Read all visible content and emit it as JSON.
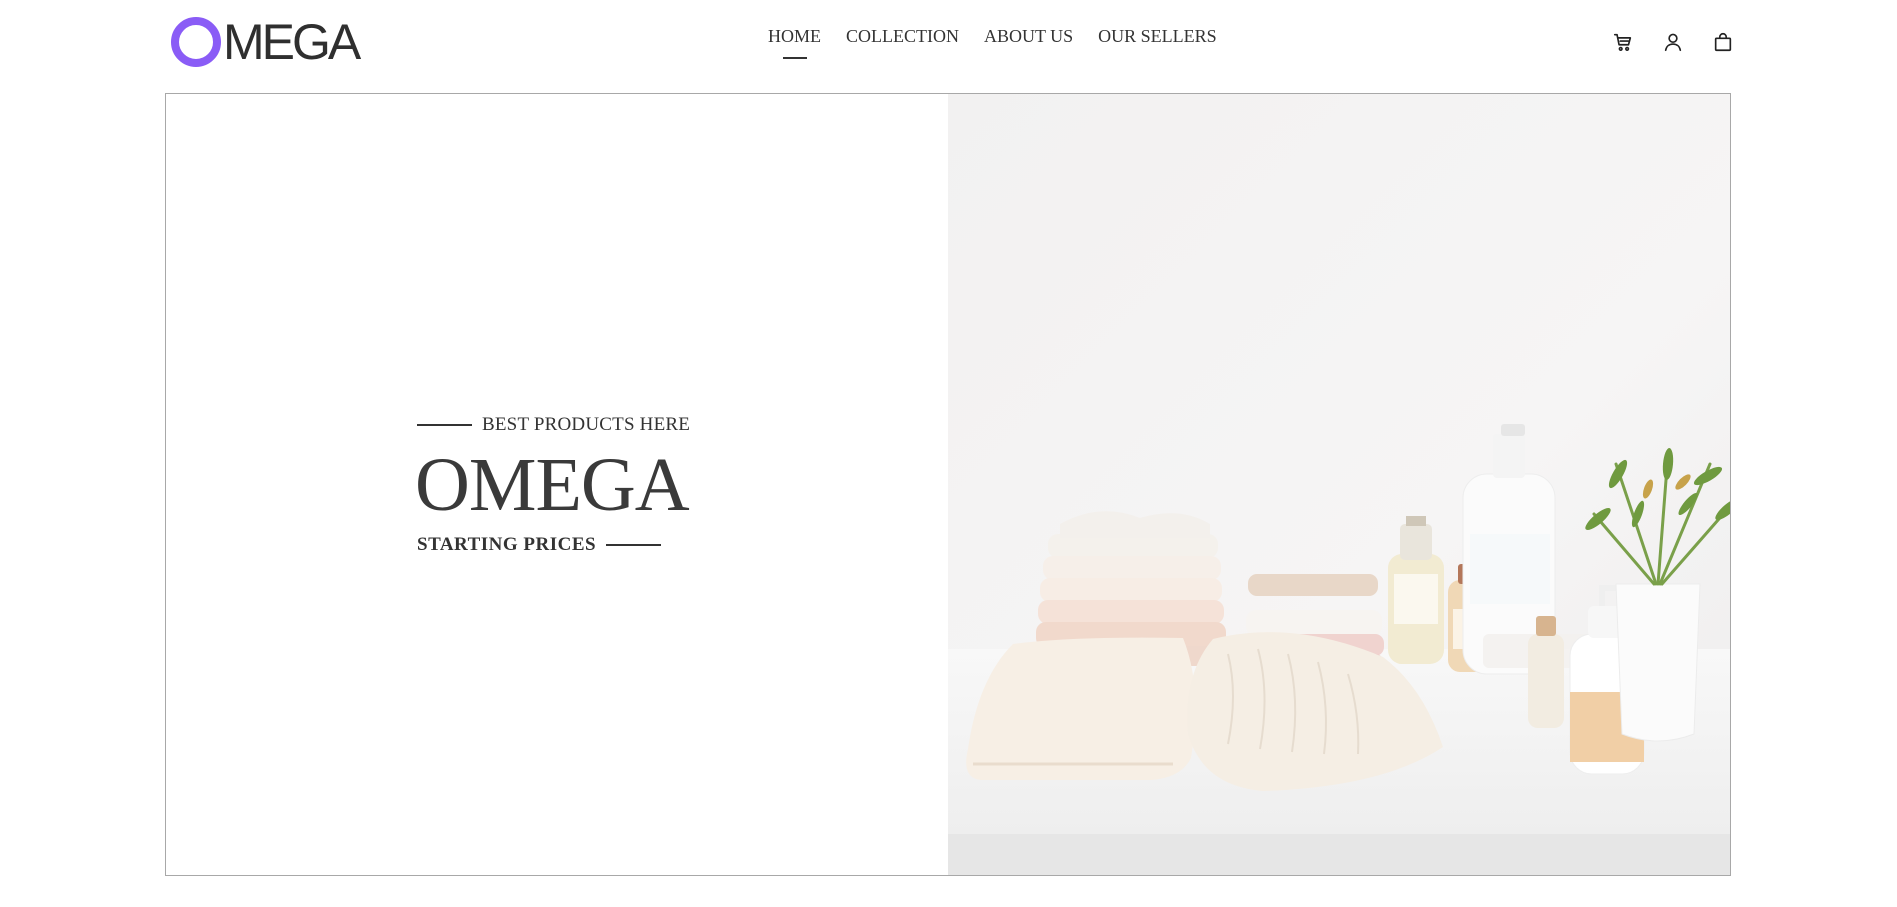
{
  "brand": {
    "logo_text": "MEGA"
  },
  "nav": {
    "items": [
      {
        "label": "HOME",
        "active": true
      },
      {
        "label": "COLLECTION",
        "active": false
      },
      {
        "label": "ABOUT US",
        "active": false
      },
      {
        "label": "OUR SELLERS",
        "active": false
      }
    ]
  },
  "header_icons": [
    "cart-icon",
    "user-icon",
    "shopping-bag-icon"
  ],
  "hero": {
    "eyebrow": "BEST PRODUCTS HERE",
    "title": "OMEGA",
    "subline": "STARTING PRICES",
    "image": "folded-towels-and-toiletries-photo"
  },
  "colors": {
    "brand_accent": "#8a5cf6",
    "text": "#333333",
    "border": "#a8a8a8"
  }
}
